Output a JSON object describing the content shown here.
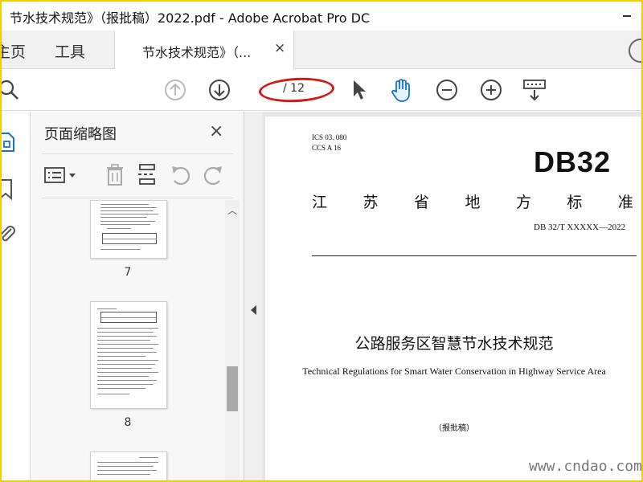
{
  "window": {
    "title": "节水技术规范》（报批稿）2022.pdf - Adobe Acrobat Pro DC"
  },
  "tabs": {
    "home": "主页",
    "tools": "工具",
    "document": "节水技术规范》（...",
    "close": "×"
  },
  "toolbar": {
    "page_total": "/ 12",
    "icons": [
      "search-icon",
      "prev-page-icon",
      "next-page-icon",
      "select-cursor-icon",
      "hand-tool-icon",
      "zoom-out-icon",
      "zoom-in-icon",
      "keyboard-icon"
    ],
    "annotation_color": "#d21919"
  },
  "panel": {
    "title": "页面缩略图",
    "close": "×",
    "thumbnails": [
      {
        "page": "7"
      },
      {
        "page": "8"
      }
    ]
  },
  "document": {
    "ics": "ICS    03. 080",
    "ccs": "CCS    A 16",
    "db": "DB32",
    "standard_chars": [
      "江",
      "苏",
      "省",
      "地",
      "方",
      "标",
      "准"
    ],
    "code": "DB 32/T  XXXXX—2022",
    "title_cn": "公路服务区智慧节水技术规范",
    "title_en": "Technical Regulations for Smart Water Conservation in Highway Service Area",
    "draft": "（报批稿）"
  },
  "watermark": "www.cndao.com"
}
